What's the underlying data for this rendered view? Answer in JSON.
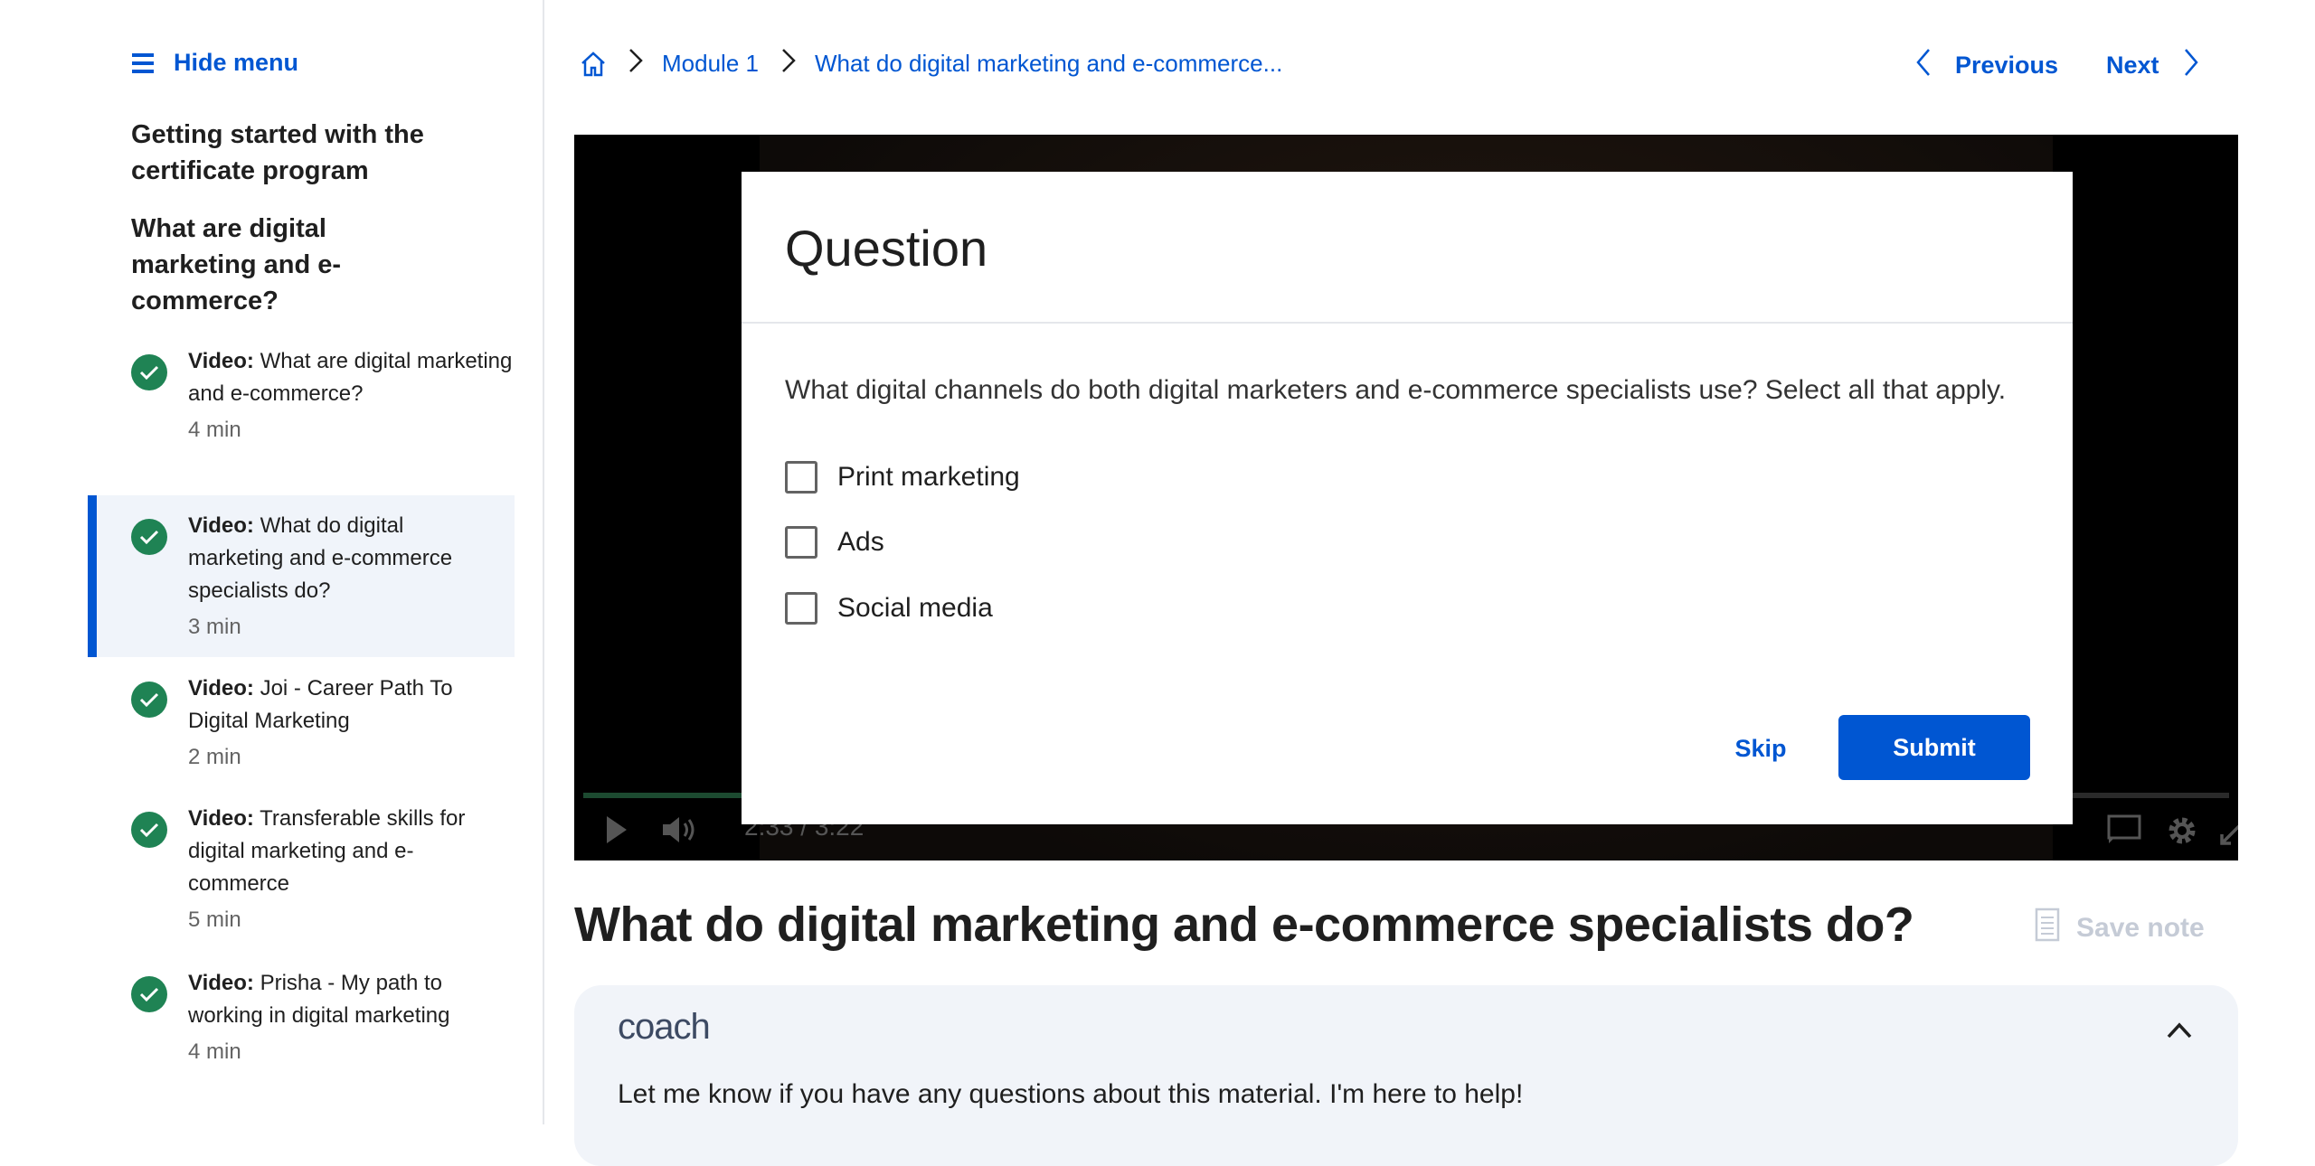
{
  "sidebar": {
    "hide_menu": "Hide menu",
    "section_title": "Getting started with the certificate program",
    "subsection_title": "What are digital marketing and e-commerce?",
    "items": [
      {
        "type": "Video:",
        "title": "What are digital marketing and e-commerce?",
        "duration": "4 min",
        "completed": true,
        "active": false
      },
      {
        "type": "Video:",
        "title": "What do digital marketing and e-commerce specialists do?",
        "duration": "3 min",
        "completed": true,
        "active": true
      },
      {
        "type": "Video:",
        "title": "Joi - Career Path To Digital Marketing",
        "duration": "2 min",
        "completed": true,
        "active": false
      },
      {
        "type": "Video:",
        "title": "Transferable skills for digital marketing and e-commerce",
        "duration": "5 min",
        "completed": true,
        "active": false
      },
      {
        "type": "Video:",
        "title": "Prisha - My path to working in digital marketing",
        "duration": "4 min",
        "completed": true,
        "active": false
      }
    ]
  },
  "breadcrumb": {
    "module": "Module 1",
    "current": "What do digital marketing and e-commerce..."
  },
  "nav": {
    "previous": "Previous",
    "next": "Next"
  },
  "video": {
    "time": "2:33 / 3:22",
    "progress_fraction": 0.76
  },
  "question": {
    "title": "Question",
    "prompt": "What digital channels do both digital marketers and e-commerce specialists use? Select all that apply.",
    "options": [
      {
        "label": "Print marketing",
        "checked": false
      },
      {
        "label": "Ads",
        "checked": false
      },
      {
        "label": "Social media",
        "checked": false
      }
    ],
    "skip": "Skip",
    "submit": "Submit"
  },
  "page_title": "What do digital marketing and e-commerce specialists do?",
  "save_note": "Save note",
  "coach": {
    "logo": "coach",
    "message": "Let me know if you have any questions about this material. I'm here to help!"
  },
  "colors": {
    "accent": "#0056d2",
    "success": "#1f8354",
    "active_bg": "#f0f4fa"
  }
}
